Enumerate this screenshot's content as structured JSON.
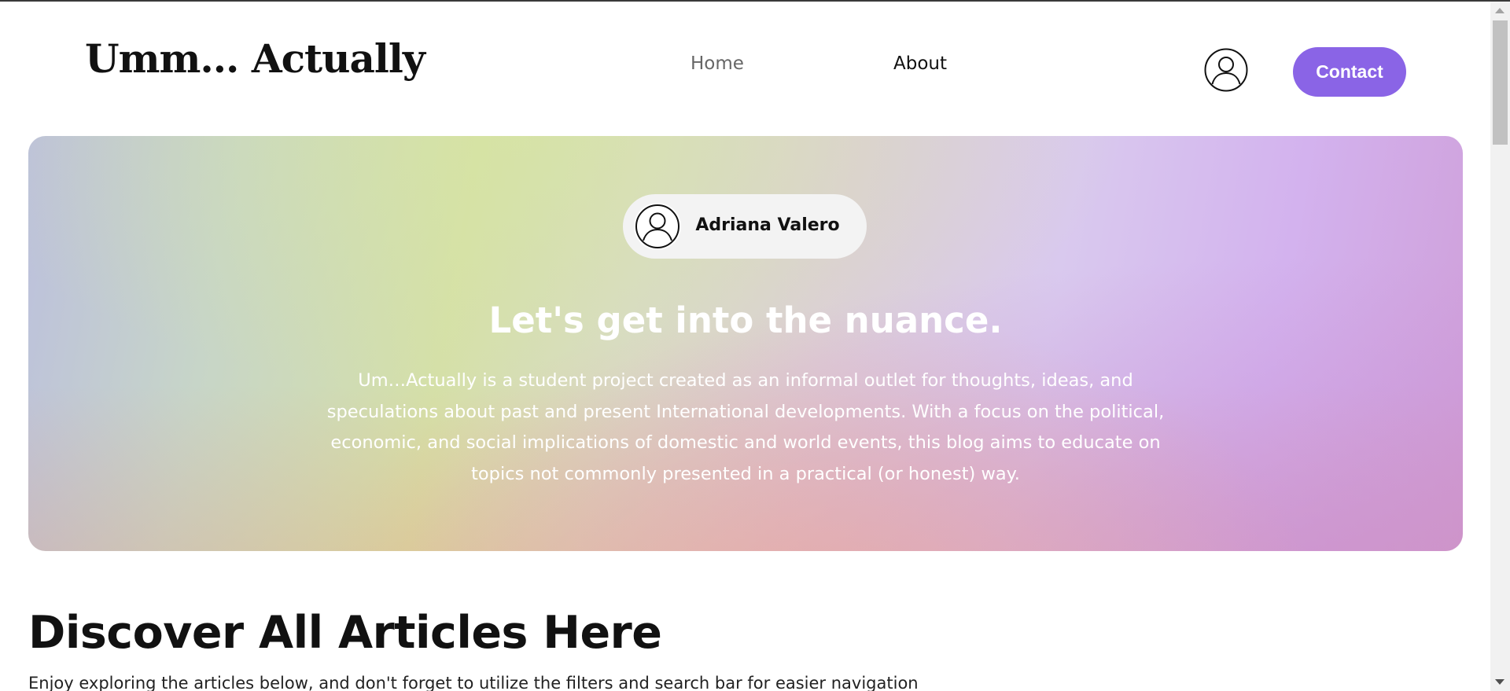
{
  "header": {
    "brand": "Umm… Actually",
    "nav": {
      "home": "Home",
      "about": "About"
    },
    "account_icon": "user-circle-icon",
    "contact_label": "Contact"
  },
  "hero": {
    "author_name": "Adriana Valero",
    "author_icon": "user-circle-icon",
    "title": "Let's get into the nuance.",
    "description": "Um…Actually is a student project created as an informal outlet for thoughts, ideas, and speculations about past and present International developments. With a focus on the political, economic, and social implications of domestic and world events, this blog aims to educate on topics not commonly presented in a practical (or honest) way."
  },
  "discover": {
    "title": "Discover All Articles Here",
    "subtitle": "Enjoy exploring the articles below, and don't forget to utilize the filters and search bar for easier navigation"
  },
  "colors": {
    "accent": "#8a64e6",
    "text": "#111111",
    "nav_inactive": "#666666"
  }
}
